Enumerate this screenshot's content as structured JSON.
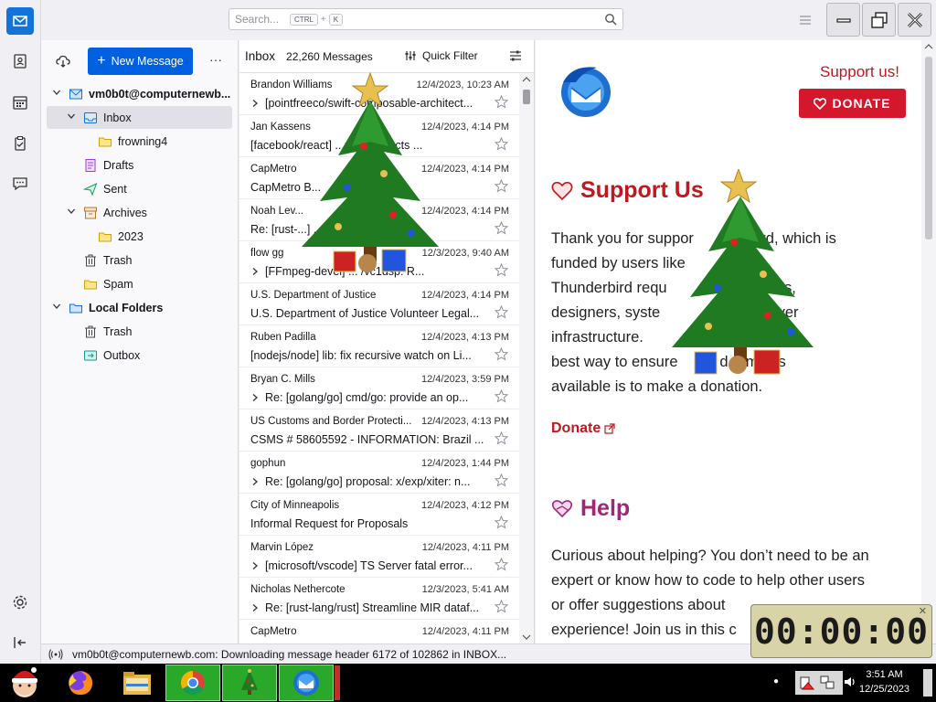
{
  "spaces": {
    "items": [
      "mail-icon",
      "address-book-icon",
      "calendar-icon",
      "tasks-icon",
      "chat-icon"
    ],
    "settings_icon": "gear-icon",
    "collapse_icon": "collapse-icon"
  },
  "titlebar": {
    "search_placeholder": "Search...",
    "kbd_ctrl": "CTRL",
    "kbd_plus": "+",
    "kbd_k": "K"
  },
  "folder_pane": {
    "new_message_label": "New Message",
    "more_label": "···",
    "folders": [
      {
        "label": "vm0b0t@computernewb...",
        "level": 0,
        "twisty": "v",
        "icon": "account-icon",
        "bold": true
      },
      {
        "label": "Inbox",
        "level": 1,
        "twisty": "v",
        "icon": "inbox-icon",
        "selected": true
      },
      {
        "label": "frowning4",
        "level": 2,
        "icon": "folder-icon"
      },
      {
        "label": "Drafts",
        "level": 1,
        "icon": "drafts-icon"
      },
      {
        "label": "Sent",
        "level": 1,
        "icon": "sent-icon"
      },
      {
        "label": "Archives",
        "level": 1,
        "twisty": "v",
        "icon": "archive-icon"
      },
      {
        "label": "2023",
        "level": 2,
        "icon": "folder-icon"
      },
      {
        "label": "Trash",
        "level": 1,
        "icon": "trash-icon"
      },
      {
        "label": "Spam",
        "level": 1,
        "icon": "spam-folder-icon"
      },
      {
        "label": "Local Folders",
        "level": 0,
        "twisty": "v",
        "icon": "local-folders-icon",
        "bold": true
      },
      {
        "label": "Trash",
        "level": 1,
        "icon": "trash-icon"
      },
      {
        "label": "Outbox",
        "level": 1,
        "icon": "outbox-icon"
      }
    ]
  },
  "message_list": {
    "folder_title": "Inbox",
    "message_count": "22,260 Messages",
    "quick_filter_label": "Quick Filter",
    "rows": [
      {
        "sender": "Brandon Williams",
        "date": "12/4/2023, 10:23 AM",
        "subject": "[pointfreeco/swift-composable-architect...",
        "thread": true
      },
      {
        "sender": "Jan Kassens",
        "date": "12/4/2023, 4:14 PM",
        "subject": "[facebook/react] ...more objects ...",
        "thread": false
      },
      {
        "sender": "CapMetro",
        "date": "12/4/2023, 4:14 PM",
        "subject": "CapMetro B...",
        "thread": false
      },
      {
        "sender": "Noah Lev...",
        "date": "12/4/2023, 4:14 PM",
        "subject": "Re: [rust-...] ...for ...",
        "thread": false
      },
      {
        "sender": "flow gg",
        "date": "12/3/2023, 9:40 AM",
        "subject": "[FFmpeg-devel] ... /vc1dsp: R...",
        "thread": true
      },
      {
        "sender": "U.S. Department of Justice",
        "date": "12/4/2023, 4:14 PM",
        "subject": "U.S. Department of Justice Volunteer Legal...",
        "thread": false
      },
      {
        "sender": "Ruben Padilla",
        "date": "12/4/2023, 4:13 PM",
        "subject": "[nodejs/node] lib: fix recursive watch on Li...",
        "thread": false
      },
      {
        "sender": "Bryan C. Mills",
        "date": "12/4/2023, 3:59 PM",
        "subject": "Re: [golang/go] cmd/go: provide an op...",
        "thread": true
      },
      {
        "sender": "US Customs and Border Protecti...",
        "date": "12/4/2023, 4:13 PM",
        "subject": "CSMS # 58605592 - INFORMATION: Brazil ...",
        "thread": false
      },
      {
        "sender": "gophun",
        "date": "12/4/2023, 1:44 PM",
        "subject": "Re: [golang/go] proposal: x/exp/xiter: n...",
        "thread": true
      },
      {
        "sender": "City of Minneapolis",
        "date": "12/4/2023, 4:12 PM",
        "subject": "Informal Request for Proposals",
        "thread": false
      },
      {
        "sender": "Marvin López",
        "date": "12/4/2023, 4:11 PM",
        "subject": "[microsoft/vscode] TS Server fatal error...",
        "thread": true
      },
      {
        "sender": "Nicholas Nethercote",
        "date": "12/3/2023, 5:41 AM",
        "subject": "Re: [rust-lang/rust] Streamline MIR dataf...",
        "thread": true
      },
      {
        "sender": "CapMetro",
        "date": "12/4/2023, 4:11 PM",
        "subject": "",
        "thread": false
      }
    ]
  },
  "content": {
    "support_link_top": "Support us!",
    "donate_button": "DONATE",
    "support_heading": "Support Us",
    "support_paragraph": "Thank you for support... underbird, which is funded by users like ... cing Thunderbird requ... ngineers, designers, syste... nd server infrastructure. ... rbird, the best way to ensure ... remains available is to make a donation.",
    "support_lines": [
      "Thank you for suppor      nderbird, which is",
      "funded by users like         cing",
      "Thunderbird requ                  gineers,",
      "designers, syste                  nd server",
      "infrastructure.                  rbird, the",
      "best way to ensure          d remains",
      "available is to make a donation."
    ],
    "donate_link": "Donate",
    "help_heading": "Help",
    "help_lines": [
      "Curious about helping? You don’t need to be an",
      "expert or know how to code to help other users",
      "or offer suggestions about",
      "experience! Join us in this c"
    ]
  },
  "status_bar": {
    "text": "vm0b0t@computernewb.com: Downloading message header 6172 of 102862 in INBOX..."
  },
  "timer": {
    "value": "00:00:00"
  },
  "taskbar": {
    "time": "3:51 AM",
    "date": "12/25/2023"
  },
  "colors": {
    "accent": "#0060df",
    "donate_red": "#d5172b",
    "help_purple": "#a12678",
    "taskbar_app_green": "#2aa82a"
  }
}
